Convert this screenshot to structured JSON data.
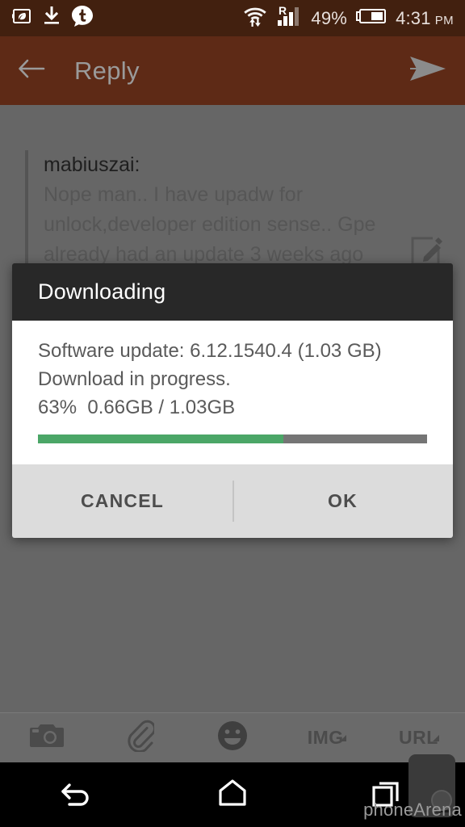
{
  "status_bar": {
    "background": "#42200f",
    "left_icons": [
      "battery-saver-leaf-icon",
      "download-icon",
      "tumblr-notification-icon"
    ],
    "wifi_icon": "wifi-transfer-icon",
    "signal_icon": "cellular-signal-roaming-icon",
    "roaming_label": "R",
    "battery_percent": "49%",
    "battery_icon": "battery-icon",
    "time": "4:31",
    "time_period": "PM"
  },
  "app_bar": {
    "background": "#5e2a16",
    "back_icon": "back-arrow-icon",
    "title": "Reply",
    "send_icon": "send-icon"
  },
  "content": {
    "quote": {
      "author": "mabiuszai:",
      "text": "Nope man.. I have upadw for unlock,developer edition sense.. Gpe already had an update 3 weeks ago"
    },
    "edit_icon": "edit-compose-icon"
  },
  "dialog": {
    "title": "Downloading",
    "header_background": "#282828",
    "line1": "Software update: 6.12.1540.4 (1.03 GB)",
    "line2": "Download in progress.",
    "line3": "63%  0.66GB / 1.03GB",
    "progress": {
      "percent": 63,
      "downloaded": "0.66GB",
      "total": "1.03GB",
      "fill_color": "#4ba667",
      "track_color": "#757575"
    },
    "buttons": {
      "cancel": "CANCEL",
      "ok": "OK"
    }
  },
  "compose_toolbar": {
    "items": [
      {
        "name": "camera-icon",
        "label": "",
        "caret": false
      },
      {
        "name": "attachment-paperclip-icon",
        "label": "",
        "caret": false
      },
      {
        "name": "emoji-smiley-icon",
        "label": "",
        "caret": false
      },
      {
        "name": "image-tag-button",
        "label": "IMG",
        "caret": true
      },
      {
        "name": "url-tag-button",
        "label": "URL",
        "caret": true
      }
    ],
    "img_label": "IMG",
    "url_label": "URL"
  },
  "nav_bar": {
    "back_icon": "nav-back-icon",
    "home_icon": "nav-home-icon",
    "recents_icon": "nav-recents-icon"
  },
  "watermark": {
    "text": "phoneArena"
  }
}
